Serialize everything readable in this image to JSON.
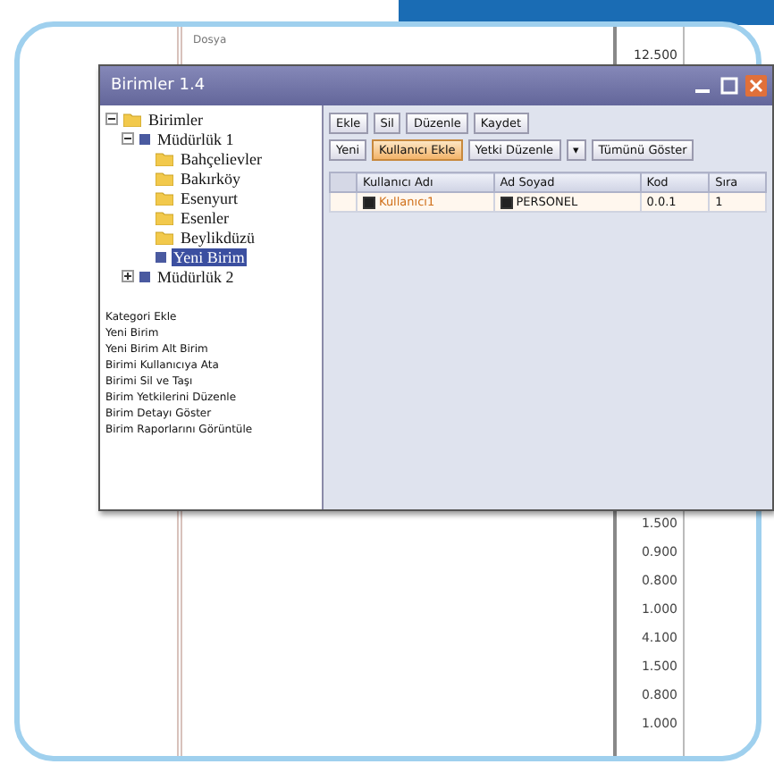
{
  "app": {
    "menu_label": "Dosya",
    "top_value": "12.500",
    "column_values": [
      "1.500",
      "0.900",
      "0.800",
      "1.000",
      "4.100",
      "1.500",
      "0.800",
      "1.000"
    ]
  },
  "dialog": {
    "title": "Birimler 1.4",
    "tree": [
      {
        "label": "Birimler",
        "kind": "folder",
        "expanded": true,
        "selected": false,
        "children": [
          {
            "label": "Müdürlük 1",
            "kind": "unit",
            "expanded": true,
            "selected": false,
            "children": [
              {
                "label": "Bahçelievler",
                "kind": "folder",
                "selected": false
              },
              {
                "label": "Bakırköy",
                "kind": "folder",
                "selected": false
              },
              {
                "label": "Esenyurt",
                "kind": "folder",
                "selected": false
              },
              {
                "label": "Esenler",
                "kind": "folder",
                "selected": false
              },
              {
                "label": "Beylikdüzü",
                "kind": "folder",
                "selected": false
              },
              {
                "label": "Yeni Birim",
                "kind": "unit",
                "selected": true
              }
            ]
          },
          {
            "label": "Müdürlük 2",
            "kind": "unit",
            "expanded": false,
            "selected": false
          }
        ]
      }
    ],
    "actions": [
      "Kategori Ekle",
      "Yeni Birim",
      "Yeni Birim Alt Birim",
      "Birimi Kullanıcıya Ata",
      "Birimi Sil ve Taşı",
      "Birim Yetkilerini Düzenle",
      "Birim Detayı Göster",
      "Birim Raporlarını Görüntüle"
    ],
    "toolbar": [
      "Ekle",
      "Sil",
      "Düzenle",
      "Kaydet"
    ],
    "toolbar2": [
      {
        "label": "Yeni",
        "selected": false
      },
      {
        "label": "Kullanıcı Ekle",
        "selected": true
      },
      {
        "label": "Yetki Düzenle",
        "selected": false
      },
      {
        "label": "▾",
        "selected": false
      },
      {
        "label": "Tümünü Göster",
        "selected": false
      }
    ],
    "table": {
      "columns": [
        "Kullanıcı Adı",
        "Ad Soyad",
        "Kod",
        "Sıra"
      ],
      "rows": [
        {
          "selected": true,
          "cells": [
            {
              "text": "Kullanıcı1",
              "checked": true
            },
            {
              "text": "PERSONEL",
              "checked": true
            },
            {
              "text": "0.0.1"
            },
            {
              "text": "1"
            }
          ]
        }
      ]
    }
  }
}
